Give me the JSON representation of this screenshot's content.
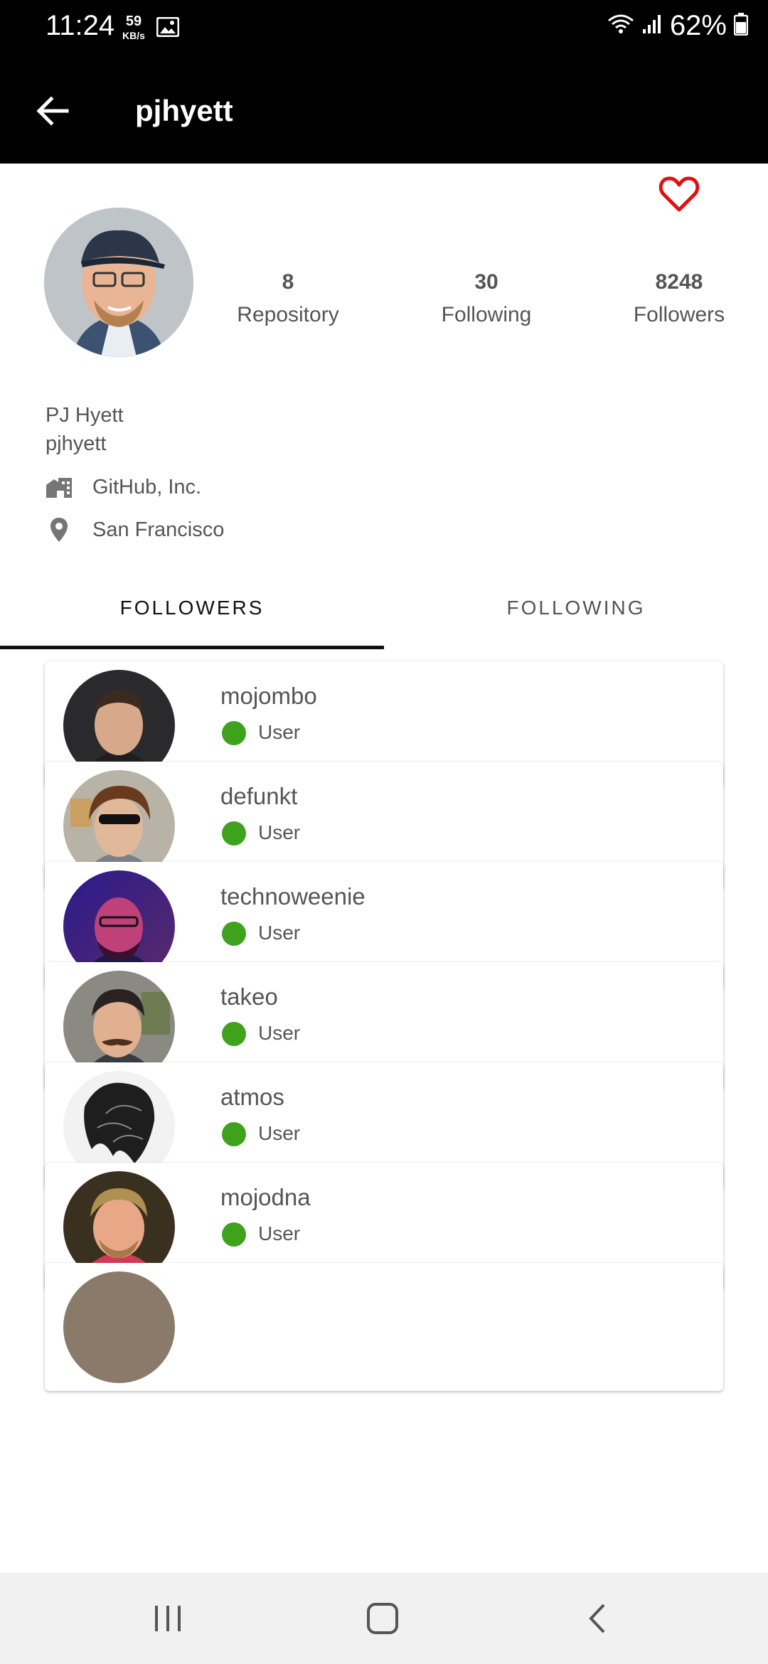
{
  "status_bar": {
    "time": "11:24",
    "net_speed": "59",
    "net_unit": "KB/s",
    "battery": "62%",
    "icons": [
      "image-icon",
      "wifi-icon",
      "signal-icon",
      "battery-icon"
    ]
  },
  "app_bar": {
    "title": "pjhyett",
    "back_icon": "arrow-left-icon"
  },
  "profile": {
    "favorite_icon": "heart-outline-icon",
    "accent_color": "#e01010",
    "stats": [
      {
        "value": "8",
        "label": "Repository"
      },
      {
        "value": "30",
        "label": "Following"
      },
      {
        "value": "8248",
        "label": "Followers"
      }
    ],
    "name": "PJ Hyett",
    "login": "pjhyett",
    "company": "GitHub, Inc.",
    "location": "San Francisco"
  },
  "tabs": [
    {
      "label": "FOLLOWERS",
      "active": true
    },
    {
      "label": "FOLLOWING",
      "active": false
    }
  ],
  "followers": [
    {
      "login": "mojombo",
      "type": "User",
      "status_color": "#3ea21d"
    },
    {
      "login": "defunkt",
      "type": "User",
      "status_color": "#3ea21d"
    },
    {
      "login": "technoweenie",
      "type": "User",
      "status_color": "#3ea21d"
    },
    {
      "login": "takeo",
      "type": "User",
      "status_color": "#3ea21d"
    },
    {
      "login": "atmos",
      "type": "User",
      "status_color": "#3ea21d"
    },
    {
      "login": "mojodna",
      "type": "User",
      "status_color": "#3ea21d"
    }
  ],
  "nav_bar": {
    "icons": [
      "recent-apps-icon",
      "home-icon",
      "back-icon"
    ]
  }
}
